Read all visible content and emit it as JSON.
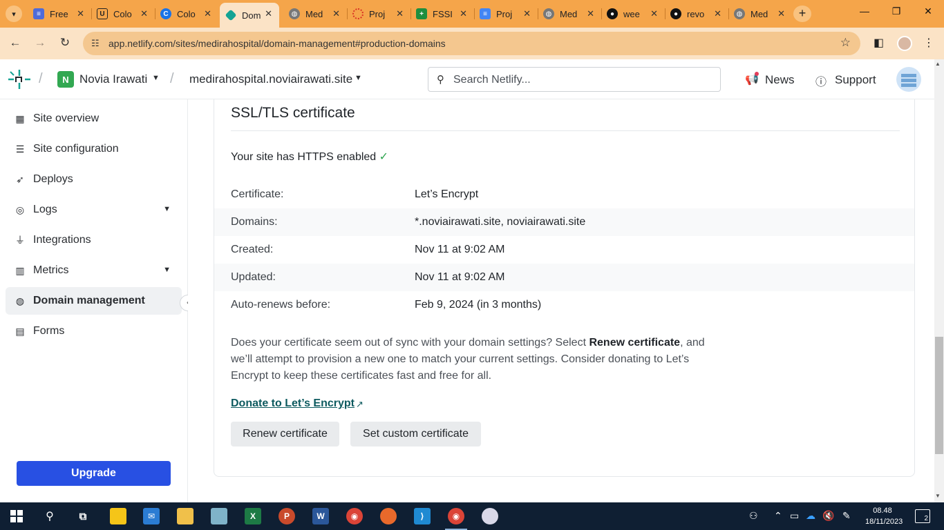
{
  "browser": {
    "tabs": [
      {
        "title": "Free",
        "favicon": "google-forms-icon",
        "color": "#4f6bd8"
      },
      {
        "title": "Colo",
        "favicon": "shield-icon",
        "color": "#f5a54a"
      },
      {
        "title": "Colo",
        "favicon": "colab-icon",
        "color": "#1a73e8"
      },
      {
        "title": "Dom",
        "favicon": "netlify-icon",
        "color": "#14a394",
        "active": true
      },
      {
        "title": "Med",
        "favicon": "globe-icon",
        "color": "#555555"
      },
      {
        "title": "Proj",
        "favicon": "circle-icon",
        "color": "#d93025"
      },
      {
        "title": "FSSI",
        "favicon": "sheets-icon",
        "color": "#1e8e3e"
      },
      {
        "title": "Proj",
        "favicon": "docs-icon",
        "color": "#4285f4"
      },
      {
        "title": "Med",
        "favicon": "globe-icon",
        "color": "#555555"
      },
      {
        "title": "wee",
        "favicon": "github-icon",
        "color": "#111111"
      },
      {
        "title": "revo",
        "favicon": "github-icon",
        "color": "#111111"
      },
      {
        "title": "Med",
        "favicon": "globe-icon",
        "color": "#555555"
      }
    ],
    "url": "app.netlify.com/sites/medirahospital/domain-management#production-domains"
  },
  "header": {
    "team_initial": "N",
    "team_name": "Novia Irawati",
    "site_name": "medirahospital.noviairawati.site",
    "search_placeholder": "Search Netlify...",
    "news_label": "News",
    "support_label": "Support"
  },
  "sidebar": {
    "items": [
      {
        "label": "Site overview",
        "icon": "grid-icon"
      },
      {
        "label": "Site configuration",
        "icon": "list-icon"
      },
      {
        "label": "Deploys",
        "icon": "rocket-icon"
      },
      {
        "label": "Logs",
        "icon": "logs-icon",
        "chevron": true
      },
      {
        "label": "Integrations",
        "icon": "plug-icon"
      },
      {
        "label": "Metrics",
        "icon": "chart-icon",
        "chevron": true
      },
      {
        "label": "Domain management",
        "icon": "globe-icon",
        "active": true
      },
      {
        "label": "Forms",
        "icon": "forms-icon"
      }
    ],
    "upgrade_label": "Upgrade"
  },
  "certificate": {
    "title": "SSL/TLS certificate",
    "https_status": "Your site has HTTPS enabled",
    "check_mark": "✓",
    "rows": [
      {
        "key": "Certificate:",
        "value": "Let’s Encrypt"
      },
      {
        "key": "Domains:",
        "value": "*.noviairawati.site, noviairawati.site"
      },
      {
        "key": "Created:",
        "value": "Nov 11 at 9:02 AM"
      },
      {
        "key": "Updated:",
        "value": "Nov 11 at 9:02 AM"
      },
      {
        "key": "Auto-renews before:",
        "value": "Feb 9, 2024 (in 3 months)"
      }
    ],
    "paragraph_before": "Does your certificate seem out of sync with your domain settings? Select ",
    "paragraph_bold": "Renew certificate",
    "paragraph_after": ", and we’ll attempt to provision a new one to match your current settings. Consider donating to Let’s Encrypt to keep these certificates fast and free for all.",
    "donate_link": "Donate to Let’s Encrypt",
    "renew_button": "Renew certificate",
    "custom_button": "Set custom certificate"
  },
  "taskbar": {
    "time": "08.48",
    "date": "18/11/2023",
    "notification_count": "2"
  }
}
